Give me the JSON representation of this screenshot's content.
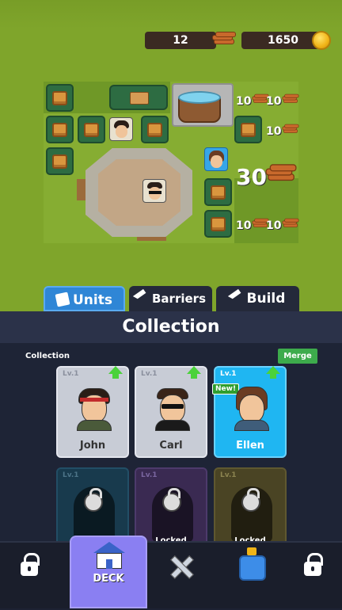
{
  "resources": {
    "wood": "12",
    "coins": "1650"
  },
  "board": {
    "big_wood_cost": "30",
    "costs": [
      "10",
      "10",
      "10",
      "10",
      "10",
      "10"
    ]
  },
  "tabs": [
    {
      "label": "Units",
      "icon": "cards-icon",
      "active": true
    },
    {
      "label": "Barriers",
      "icon": "hammer-icon",
      "active": false
    },
    {
      "label": "Build",
      "icon": "hammer-icon",
      "active": false
    }
  ],
  "collection": {
    "title": "Collection",
    "label": "Collection",
    "merge_label": "Merge",
    "cards": [
      {
        "level": "Lv.1",
        "name": "John",
        "state": "unlocked",
        "color": "#c8ccd6"
      },
      {
        "level": "Lv.1",
        "name": "Carl",
        "state": "unlocked",
        "color": "#c8ccd6"
      },
      {
        "level": "Lv.1",
        "name": "Ellen",
        "state": "unlocked",
        "color": "#1fb6f2",
        "badge": "New!"
      }
    ],
    "locked_cards": [
      {
        "level": "Lv.1",
        "label": "Locked",
        "color": "#183a4d"
      },
      {
        "level": "Lv.1",
        "label": "Locked",
        "color": "#3a2a52"
      },
      {
        "level": "Lv.1",
        "label": "Locked",
        "color": "#4a4424"
      }
    ]
  },
  "nav": {
    "deck_label": "DECK"
  }
}
